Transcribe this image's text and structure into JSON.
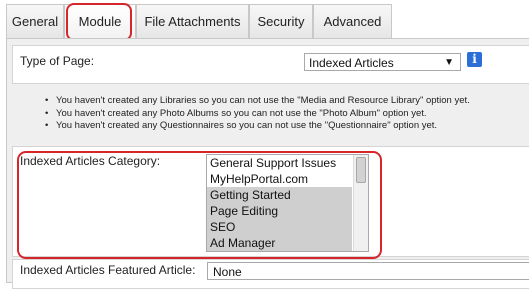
{
  "tabs": [
    {
      "label": "General"
    },
    {
      "label": "Module",
      "active": true
    },
    {
      "label": "File Attachments"
    },
    {
      "label": "Security"
    },
    {
      "label": "Advanced"
    }
  ],
  "type_of_page": {
    "label": "Type of Page:",
    "selected": "Indexed Articles",
    "info_icon": "info-icon"
  },
  "notices": [
    "You haven't created any Libraries so you can not use the \"Media and Resource Library\" option yet.",
    "You haven't created any Photo Albums so you can not use the \"Photo Album\" option yet.",
    "You haven't created any Questionnaires so you can not use the \"Questionnaire\" option yet."
  ],
  "category": {
    "label": "Indexed Articles Category:",
    "options": [
      {
        "label": "General Support Issues",
        "selected": false
      },
      {
        "label": "MyHelpPortal.com",
        "selected": false
      },
      {
        "label": "Getting Started",
        "selected": true
      },
      {
        "label": "Page Editing",
        "selected": true
      },
      {
        "label": "SEO",
        "selected": true
      },
      {
        "label": "Ad Manager",
        "selected": true
      }
    ]
  },
  "featured": {
    "label": "Indexed Articles Featured Article:",
    "selected": "None"
  },
  "colors": {
    "highlight": "#d6262b",
    "info_icon": "#2b6fd6",
    "selected_option": "#cfcfcf"
  }
}
